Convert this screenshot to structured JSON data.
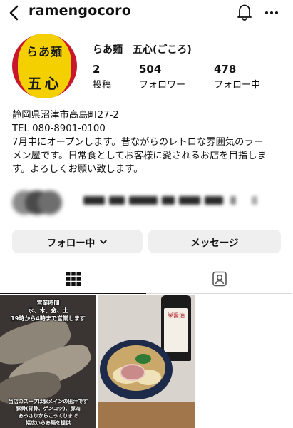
{
  "header": {
    "username": "ramengocoro",
    "back_icon": "chevron-left-icon",
    "bell_icon": "bell-icon",
    "more_icon": "more-horizontal-icon"
  },
  "profile": {
    "avatar_text_line1": "らあ麺",
    "avatar_text_line2": "五心",
    "display_name": "らあ麺　五心(ごころ)",
    "stats": {
      "posts_count": "2",
      "posts_label": "投稿",
      "followers_count": "504",
      "followers_label": "フォロワー",
      "following_count": "478",
      "following_label": "フォロー中"
    },
    "bio": {
      "line1": "静岡県沼津市高島町27-2",
      "line2": "TEL 080-8901-0100",
      "line3": "7月中にオープンします。昔ながらのレトロな雰囲気のラー",
      "line4": "メン屋です。日常食としてお客様に愛されるお店を目指しま",
      "line5": "す。よろしくお願い致します。"
    }
  },
  "buttons": {
    "follow_label": "フォロー中",
    "message_label": "メッセージ"
  },
  "tabs": {
    "grid_icon": "grid-icon",
    "tagged_icon": "tagged-person-icon"
  },
  "posts": {
    "post1": {
      "top_line1": "営業時間",
      "top_line2": "水、木、金、土",
      "top_line3": "19時から4時まで営業します",
      "bottom_line1": "当店のスープは豚メインの出汁です",
      "bottom_line2": "豚骨(背骨、ゲンコツ)、豚肉",
      "bottom_line3": "あっさりからこってりまで",
      "bottom_line4": "幅広いらあ麺を提供"
    },
    "post2": {
      "bottle_label": "栄醤油"
    }
  },
  "colors": {
    "avatar_red": "#c8172d",
    "avatar_yellow": "#f4d000",
    "button_bg": "#efefef"
  }
}
